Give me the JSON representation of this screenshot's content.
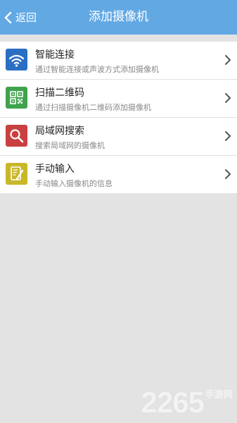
{
  "header": {
    "back_label": "返回",
    "title": "添加摄像机"
  },
  "items": [
    {
      "title": "智能连接",
      "desc": "通过智能连接或声波方式添加摄像机",
      "icon": "wifi-icon",
      "color": "#2b6fc2"
    },
    {
      "title": "扫描二维码",
      "desc": "通过扫描摄像机二维码添加摄像机",
      "icon": "qr-code-icon",
      "color": "#3fa34d"
    },
    {
      "title": "局域网搜索",
      "desc": "搜索局域网的摄像机",
      "icon": "search-icon",
      "color": "#c94040"
    },
    {
      "title": "手动输入",
      "desc": "手动输入摄像机的信息",
      "icon": "edit-icon",
      "color": "#c9b72a"
    }
  ],
  "watermark": {
    "number": "2265",
    "suffix": "手游网"
  },
  "colors": {
    "header_bg": "#62a9e4",
    "page_bg": "#e3e3e3"
  }
}
